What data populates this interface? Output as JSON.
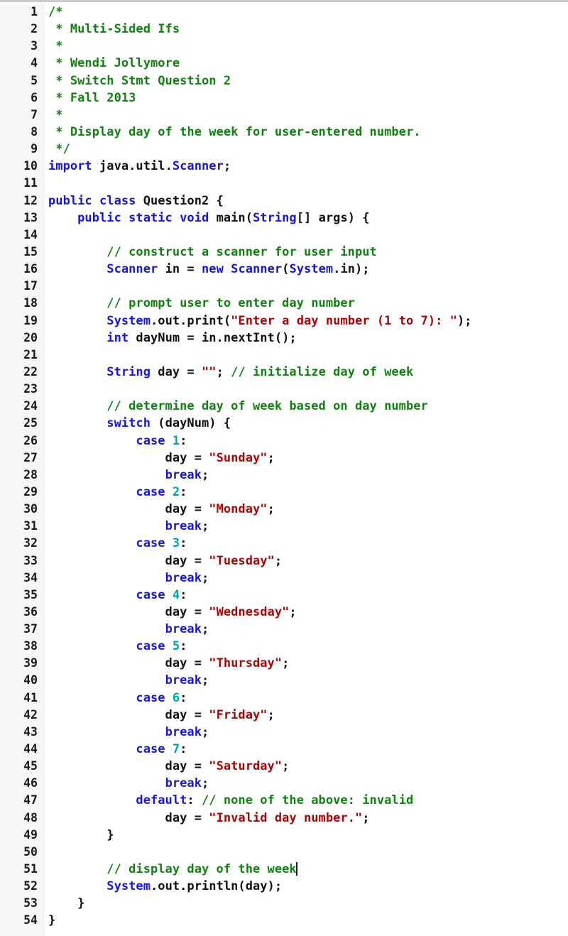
{
  "editor": {
    "language": "java",
    "gutter_background": "#f6f6f6",
    "code_background": "#ffffff",
    "first_line": 1,
    "last_line": 54,
    "total_lines": 54
  },
  "colors": {
    "keyword": "#1515dd",
    "type": "#1515dd",
    "comment": "#128012",
    "string": "#a60808",
    "number": "#00a3a3",
    "plain": "#111111",
    "line_number": "#1a1a1a",
    "caret": "#222222"
  },
  "caret": {
    "line": 51,
    "after_text": "// display day of the week"
  },
  "line_numbers": [
    "1",
    "2",
    "3",
    "4",
    "5",
    "6",
    "7",
    "8",
    "9",
    "10",
    "11",
    "12",
    "13",
    "14",
    "15",
    "16",
    "17",
    "18",
    "19",
    "20",
    "21",
    "22",
    "23",
    "24",
    "25",
    "26",
    "27",
    "28",
    "29",
    "30",
    "31",
    "32",
    "33",
    "34",
    "35",
    "36",
    "37",
    "38",
    "39",
    "40",
    "41",
    "42",
    "43",
    "44",
    "45",
    "46",
    "47",
    "48",
    "49",
    "50",
    "51",
    "52",
    "53",
    "54"
  ],
  "lines": [
    {
      "n": 1,
      "tokens": [
        {
          "t": "comment",
          "v": "/*"
        }
      ]
    },
    {
      "n": 2,
      "tokens": [
        {
          "t": "comment",
          "v": " * Multi-Sided Ifs"
        }
      ]
    },
    {
      "n": 3,
      "tokens": [
        {
          "t": "comment",
          "v": " *"
        }
      ]
    },
    {
      "n": 4,
      "tokens": [
        {
          "t": "comment",
          "v": " * Wendi Jollymore"
        }
      ]
    },
    {
      "n": 5,
      "tokens": [
        {
          "t": "comment",
          "v": " * Switch Stmt Question 2"
        }
      ]
    },
    {
      "n": 6,
      "tokens": [
        {
          "t": "comment",
          "v": " * Fall 2013"
        }
      ]
    },
    {
      "n": 7,
      "tokens": [
        {
          "t": "comment",
          "v": " *"
        }
      ]
    },
    {
      "n": 8,
      "tokens": [
        {
          "t": "comment",
          "v": " * Display day of the week for user-entered number."
        }
      ]
    },
    {
      "n": 9,
      "tokens": [
        {
          "t": "comment",
          "v": " */"
        }
      ]
    },
    {
      "n": 10,
      "tokens": [
        {
          "t": "keyword",
          "v": "import"
        },
        {
          "t": "plain",
          "v": " java.util."
        },
        {
          "t": "type",
          "v": "Scanner"
        },
        {
          "t": "plain",
          "v": ";"
        }
      ]
    },
    {
      "n": 11,
      "tokens": []
    },
    {
      "n": 12,
      "tokens": [
        {
          "t": "keyword",
          "v": "public class"
        },
        {
          "t": "plain",
          "v": " Question2 {"
        }
      ]
    },
    {
      "n": 13,
      "tokens": [
        {
          "t": "plain",
          "v": "    "
        },
        {
          "t": "keyword",
          "v": "public static void"
        },
        {
          "t": "plain",
          "v": " main("
        },
        {
          "t": "type",
          "v": "String"
        },
        {
          "t": "plain",
          "v": "[] args) {"
        }
      ]
    },
    {
      "n": 14,
      "tokens": []
    },
    {
      "n": 15,
      "tokens": [
        {
          "t": "plain",
          "v": "        "
        },
        {
          "t": "comment",
          "v": "// construct a scanner for user input"
        }
      ]
    },
    {
      "n": 16,
      "tokens": [
        {
          "t": "plain",
          "v": "        "
        },
        {
          "t": "type",
          "v": "Scanner"
        },
        {
          "t": "plain",
          "v": " in = "
        },
        {
          "t": "keyword",
          "v": "new"
        },
        {
          "t": "plain",
          "v": " "
        },
        {
          "t": "type",
          "v": "Scanner"
        },
        {
          "t": "plain",
          "v": "("
        },
        {
          "t": "type",
          "v": "System"
        },
        {
          "t": "plain",
          "v": ".in);"
        }
      ]
    },
    {
      "n": 17,
      "tokens": []
    },
    {
      "n": 18,
      "tokens": [
        {
          "t": "plain",
          "v": "        "
        },
        {
          "t": "comment",
          "v": "// prompt user to enter day number"
        }
      ]
    },
    {
      "n": 19,
      "tokens": [
        {
          "t": "plain",
          "v": "        "
        },
        {
          "t": "type",
          "v": "System"
        },
        {
          "t": "plain",
          "v": ".out.print("
        },
        {
          "t": "string",
          "v": "\"Enter a day number (1 to 7): \""
        },
        {
          "t": "plain",
          "v": ");"
        }
      ]
    },
    {
      "n": 20,
      "tokens": [
        {
          "t": "plain",
          "v": "        "
        },
        {
          "t": "keyword",
          "v": "int"
        },
        {
          "t": "plain",
          "v": " dayNum = in.nextInt();"
        }
      ]
    },
    {
      "n": 21,
      "tokens": []
    },
    {
      "n": 22,
      "tokens": [
        {
          "t": "plain",
          "v": "        "
        },
        {
          "t": "type",
          "v": "String"
        },
        {
          "t": "plain",
          "v": " day = "
        },
        {
          "t": "string",
          "v": "\"\""
        },
        {
          "t": "plain",
          "v": "; "
        },
        {
          "t": "comment",
          "v": "// initialize day of week"
        }
      ]
    },
    {
      "n": 23,
      "tokens": []
    },
    {
      "n": 24,
      "tokens": [
        {
          "t": "plain",
          "v": "        "
        },
        {
          "t": "comment",
          "v": "// determine day of week based on day number"
        }
      ]
    },
    {
      "n": 25,
      "tokens": [
        {
          "t": "plain",
          "v": "        "
        },
        {
          "t": "keyword",
          "v": "switch"
        },
        {
          "t": "plain",
          "v": " (dayNum) {"
        }
      ]
    },
    {
      "n": 26,
      "tokens": [
        {
          "t": "plain",
          "v": "            "
        },
        {
          "t": "keyword",
          "v": "case"
        },
        {
          "t": "plain",
          "v": " "
        },
        {
          "t": "number",
          "v": "1"
        },
        {
          "t": "plain",
          "v": ":"
        }
      ]
    },
    {
      "n": 27,
      "tokens": [
        {
          "t": "plain",
          "v": "                day = "
        },
        {
          "t": "string",
          "v": "\"Sunday\""
        },
        {
          "t": "plain",
          "v": ";"
        }
      ]
    },
    {
      "n": 28,
      "tokens": [
        {
          "t": "plain",
          "v": "                "
        },
        {
          "t": "keyword",
          "v": "break"
        },
        {
          "t": "plain",
          "v": ";"
        }
      ]
    },
    {
      "n": 29,
      "tokens": [
        {
          "t": "plain",
          "v": "            "
        },
        {
          "t": "keyword",
          "v": "case"
        },
        {
          "t": "plain",
          "v": " "
        },
        {
          "t": "number",
          "v": "2"
        },
        {
          "t": "plain",
          "v": ":"
        }
      ]
    },
    {
      "n": 30,
      "tokens": [
        {
          "t": "plain",
          "v": "                day = "
        },
        {
          "t": "string",
          "v": "\"Monday\""
        },
        {
          "t": "plain",
          "v": ";"
        }
      ]
    },
    {
      "n": 31,
      "tokens": [
        {
          "t": "plain",
          "v": "                "
        },
        {
          "t": "keyword",
          "v": "break"
        },
        {
          "t": "plain",
          "v": ";"
        }
      ]
    },
    {
      "n": 32,
      "tokens": [
        {
          "t": "plain",
          "v": "            "
        },
        {
          "t": "keyword",
          "v": "case"
        },
        {
          "t": "plain",
          "v": " "
        },
        {
          "t": "number",
          "v": "3"
        },
        {
          "t": "plain",
          "v": ":"
        }
      ]
    },
    {
      "n": 33,
      "tokens": [
        {
          "t": "plain",
          "v": "                day = "
        },
        {
          "t": "string",
          "v": "\"Tuesday\""
        },
        {
          "t": "plain",
          "v": ";"
        }
      ]
    },
    {
      "n": 34,
      "tokens": [
        {
          "t": "plain",
          "v": "                "
        },
        {
          "t": "keyword",
          "v": "break"
        },
        {
          "t": "plain",
          "v": ";"
        }
      ]
    },
    {
      "n": 35,
      "tokens": [
        {
          "t": "plain",
          "v": "            "
        },
        {
          "t": "keyword",
          "v": "case"
        },
        {
          "t": "plain",
          "v": " "
        },
        {
          "t": "number",
          "v": "4"
        },
        {
          "t": "plain",
          "v": ":"
        }
      ]
    },
    {
      "n": 36,
      "tokens": [
        {
          "t": "plain",
          "v": "                day = "
        },
        {
          "t": "string",
          "v": "\"Wednesday\""
        },
        {
          "t": "plain",
          "v": ";"
        }
      ]
    },
    {
      "n": 37,
      "tokens": [
        {
          "t": "plain",
          "v": "                "
        },
        {
          "t": "keyword",
          "v": "break"
        },
        {
          "t": "plain",
          "v": ";"
        }
      ]
    },
    {
      "n": 38,
      "tokens": [
        {
          "t": "plain",
          "v": "            "
        },
        {
          "t": "keyword",
          "v": "case"
        },
        {
          "t": "plain",
          "v": " "
        },
        {
          "t": "number",
          "v": "5"
        },
        {
          "t": "plain",
          "v": ":"
        }
      ]
    },
    {
      "n": 39,
      "tokens": [
        {
          "t": "plain",
          "v": "                day = "
        },
        {
          "t": "string",
          "v": "\"Thursday\""
        },
        {
          "t": "plain",
          "v": ";"
        }
      ]
    },
    {
      "n": 40,
      "tokens": [
        {
          "t": "plain",
          "v": "                "
        },
        {
          "t": "keyword",
          "v": "break"
        },
        {
          "t": "plain",
          "v": ";"
        }
      ]
    },
    {
      "n": 41,
      "tokens": [
        {
          "t": "plain",
          "v": "            "
        },
        {
          "t": "keyword",
          "v": "case"
        },
        {
          "t": "plain",
          "v": " "
        },
        {
          "t": "number",
          "v": "6"
        },
        {
          "t": "plain",
          "v": ":"
        }
      ]
    },
    {
      "n": 42,
      "tokens": [
        {
          "t": "plain",
          "v": "                day = "
        },
        {
          "t": "string",
          "v": "\"Friday\""
        },
        {
          "t": "plain",
          "v": ";"
        }
      ]
    },
    {
      "n": 43,
      "tokens": [
        {
          "t": "plain",
          "v": "                "
        },
        {
          "t": "keyword",
          "v": "break"
        },
        {
          "t": "plain",
          "v": ";"
        }
      ]
    },
    {
      "n": 44,
      "tokens": [
        {
          "t": "plain",
          "v": "            "
        },
        {
          "t": "keyword",
          "v": "case"
        },
        {
          "t": "plain",
          "v": " "
        },
        {
          "t": "number",
          "v": "7"
        },
        {
          "t": "plain",
          "v": ":"
        }
      ]
    },
    {
      "n": 45,
      "tokens": [
        {
          "t": "plain",
          "v": "                day = "
        },
        {
          "t": "string",
          "v": "\"Saturday\""
        },
        {
          "t": "plain",
          "v": ";"
        }
      ]
    },
    {
      "n": 46,
      "tokens": [
        {
          "t": "plain",
          "v": "                "
        },
        {
          "t": "keyword",
          "v": "break"
        },
        {
          "t": "plain",
          "v": ";"
        }
      ]
    },
    {
      "n": 47,
      "tokens": [
        {
          "t": "plain",
          "v": "            "
        },
        {
          "t": "keyword",
          "v": "default"
        },
        {
          "t": "plain",
          "v": ": "
        },
        {
          "t": "comment",
          "v": "// none of the above: invalid"
        }
      ]
    },
    {
      "n": 48,
      "tokens": [
        {
          "t": "plain",
          "v": "                day = "
        },
        {
          "t": "string",
          "v": "\"Invalid day number.\""
        },
        {
          "t": "plain",
          "v": ";"
        }
      ]
    },
    {
      "n": 49,
      "tokens": [
        {
          "t": "plain",
          "v": "        }"
        }
      ]
    },
    {
      "n": 50,
      "tokens": []
    },
    {
      "n": 51,
      "tokens": [
        {
          "t": "plain",
          "v": "        "
        },
        {
          "t": "comment",
          "v": "// display day of the week"
        },
        {
          "t": "caret",
          "v": ""
        }
      ]
    },
    {
      "n": 52,
      "tokens": [
        {
          "t": "plain",
          "v": "        "
        },
        {
          "t": "type",
          "v": "System"
        },
        {
          "t": "plain",
          "v": ".out.println(day);"
        }
      ]
    },
    {
      "n": 53,
      "tokens": [
        {
          "t": "plain",
          "v": "    }"
        }
      ]
    },
    {
      "n": 54,
      "tokens": [
        {
          "t": "plain",
          "v": "}"
        }
      ]
    }
  ]
}
